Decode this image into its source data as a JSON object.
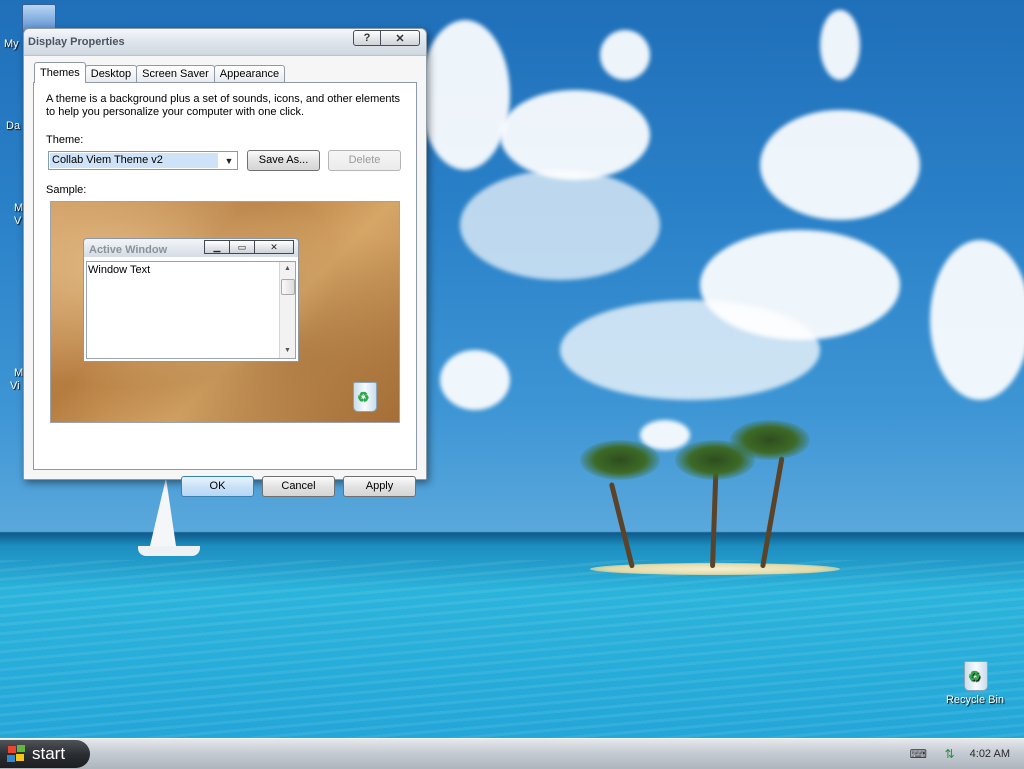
{
  "desktop": {
    "icons": {
      "my_computer": "My",
      "partial_2": "Da",
      "partial_3a": "M",
      "partial_3b": "V",
      "partial_4a": "M",
      "partial_4b": "Vi",
      "recycle_bin": "Recycle Bin"
    }
  },
  "window": {
    "title": "Display Properties",
    "help_button": "?",
    "close_button": "✕",
    "tabs": [
      {
        "label": "Themes"
      },
      {
        "label": "Desktop"
      },
      {
        "label": "Screen Saver"
      },
      {
        "label": "Appearance"
      }
    ],
    "description": "A theme is a background plus a set of sounds, icons, and other elements to help you personalize your computer with one click.",
    "theme_label": "Theme:",
    "theme_value": "Collab Viem Theme v2",
    "save_as": "Save As...",
    "delete": "Delete",
    "sample_label": "Sample:",
    "sample": {
      "active_window_title": "Active Window",
      "window_text": "Window Text"
    },
    "ok": "OK",
    "cancel": "Cancel",
    "apply": "Apply"
  },
  "taskbar": {
    "start_label": "start",
    "clock": "4:02 AM"
  },
  "colors": {
    "accent": "#3c7fb1",
    "selection": "#cfe3f8",
    "taskbar": "#c6ccd3"
  }
}
